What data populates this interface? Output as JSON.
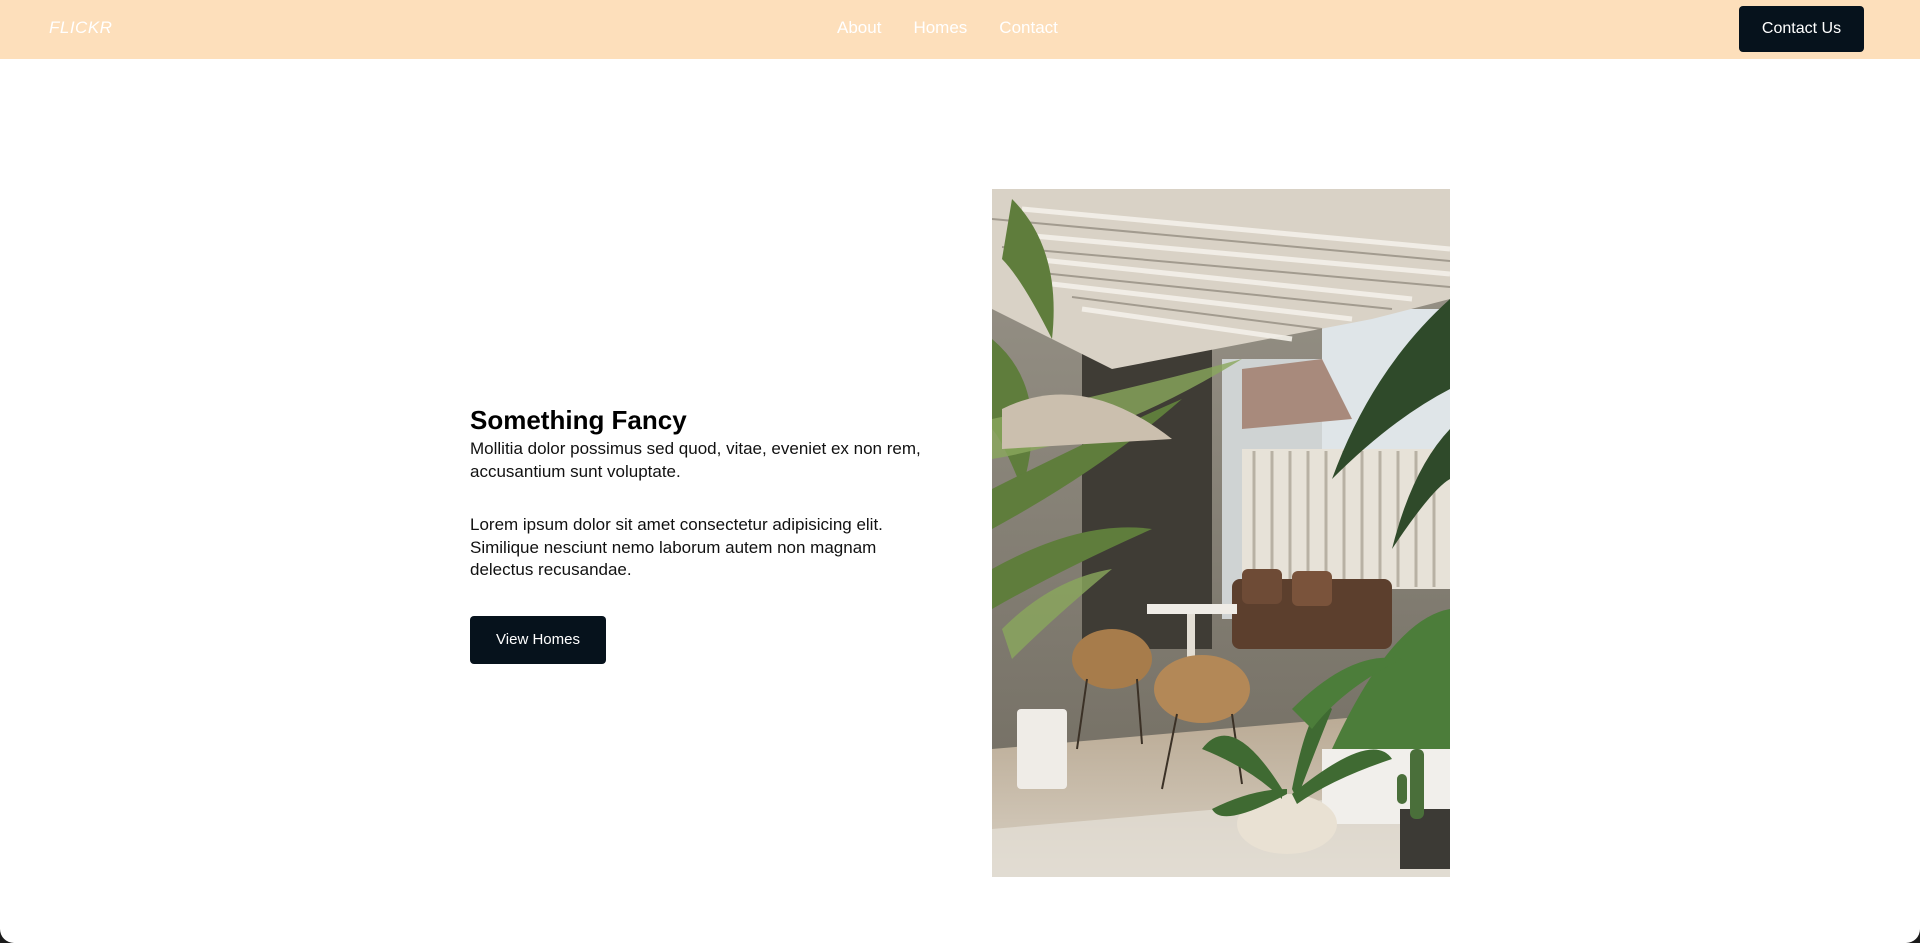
{
  "header": {
    "logo": "FLICKR",
    "nav": [
      "About",
      "Homes",
      "Contact"
    ],
    "cta_label": "Contact Us"
  },
  "hero": {
    "title": "Something Fancy",
    "paragraph_1": "Mollitia dolor possimus sed quod, vitae, eveniet ex non rem, accusantium sunt voluptate.",
    "paragraph_2": "Lorem ipsum dolor sit amet consectetur adipisicing elit. Similique nesciunt nemo laborum autem non magnam delectus recusandae.",
    "button_label": "View Homes"
  },
  "colors": {
    "header_bg": "#fddfbb",
    "button_bg": "#06121c",
    "page_bg": "#ffffff"
  }
}
